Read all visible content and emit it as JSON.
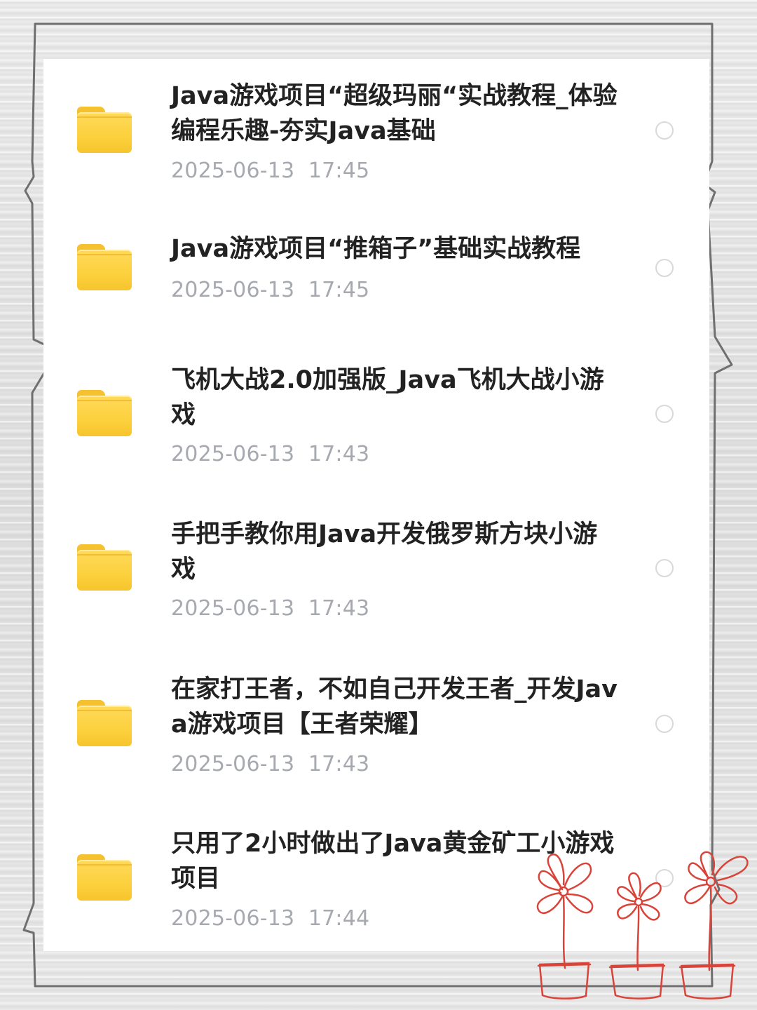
{
  "files": [
    {
      "title": "Java游戏项目“超级玛丽“实战教程_体验编程乐趣-夯实Java基础",
      "date": "2025-06-13  17:45",
      "icon": "folder-icon"
    },
    {
      "title": "Java游戏项目“推箱子”基础实战教程",
      "date": "2025-06-13  17:45",
      "icon": "folder-icon"
    },
    {
      "title": "飞机大战2.0加强版_Java飞机大战小游戏",
      "date": "2025-06-13  17:43",
      "icon": "folder-icon"
    },
    {
      "title": "手把手教你用Java开发俄罗斯方块小游戏",
      "date": "2025-06-13  17:43",
      "icon": "folder-icon"
    },
    {
      "title": "在家打王者，不如自己开发王者_开发Java游戏项目【王者荣耀】",
      "date": "2025-06-13  17:43",
      "icon": "folder-icon"
    },
    {
      "title": "只用了2小时做出了Java黄金矿工小游戏项目",
      "date": "2025-06-13  17:44",
      "icon": "folder-icon"
    }
  ],
  "colors": {
    "folder": "#fcd13e",
    "title_text": "#222222",
    "date_text": "#a7a9b0",
    "doodle": "#d9443a"
  }
}
